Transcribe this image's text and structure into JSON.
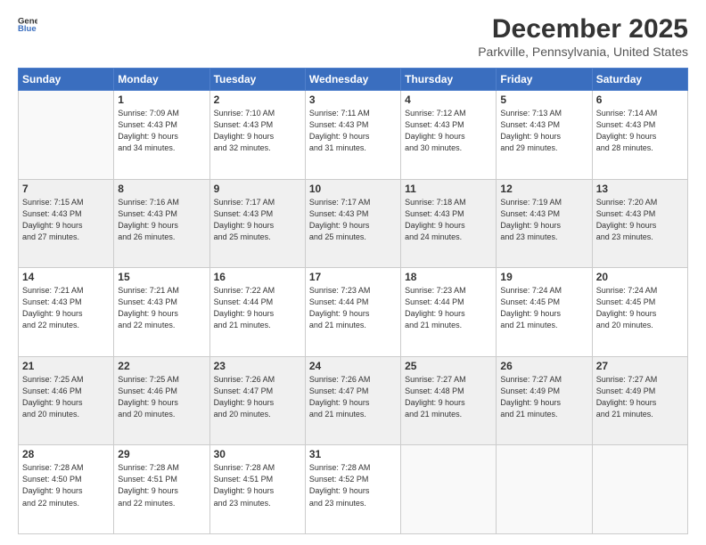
{
  "logo": {
    "line1": "General",
    "line2": "Blue"
  },
  "header": {
    "title": "December 2025",
    "subtitle": "Parkville, Pennsylvania, United States"
  },
  "weekdays": [
    "Sunday",
    "Monday",
    "Tuesday",
    "Wednesday",
    "Thursday",
    "Friday",
    "Saturday"
  ],
  "weeks": [
    [
      {
        "day": "",
        "sunrise": "",
        "sunset": "",
        "daylight": ""
      },
      {
        "day": "1",
        "sunrise": "7:09 AM",
        "sunset": "4:43 PM",
        "dl1": "9 hours",
        "dl2": "and 34 minutes."
      },
      {
        "day": "2",
        "sunrise": "7:10 AM",
        "sunset": "4:43 PM",
        "dl1": "9 hours",
        "dl2": "and 32 minutes."
      },
      {
        "day": "3",
        "sunrise": "7:11 AM",
        "sunset": "4:43 PM",
        "dl1": "9 hours",
        "dl2": "and 31 minutes."
      },
      {
        "day": "4",
        "sunrise": "7:12 AM",
        "sunset": "4:43 PM",
        "dl1": "9 hours",
        "dl2": "and 30 minutes."
      },
      {
        "day": "5",
        "sunrise": "7:13 AM",
        "sunset": "4:43 PM",
        "dl1": "9 hours",
        "dl2": "and 29 minutes."
      },
      {
        "day": "6",
        "sunrise": "7:14 AM",
        "sunset": "4:43 PM",
        "dl1": "9 hours",
        "dl2": "and 28 minutes."
      }
    ],
    [
      {
        "day": "7",
        "sunrise": "7:15 AM",
        "sunset": "4:43 PM",
        "dl1": "9 hours",
        "dl2": "and 27 minutes."
      },
      {
        "day": "8",
        "sunrise": "7:16 AM",
        "sunset": "4:43 PM",
        "dl1": "9 hours",
        "dl2": "and 26 minutes."
      },
      {
        "day": "9",
        "sunrise": "7:17 AM",
        "sunset": "4:43 PM",
        "dl1": "9 hours",
        "dl2": "and 25 minutes."
      },
      {
        "day": "10",
        "sunrise": "7:17 AM",
        "sunset": "4:43 PM",
        "dl1": "9 hours",
        "dl2": "and 25 minutes."
      },
      {
        "day": "11",
        "sunrise": "7:18 AM",
        "sunset": "4:43 PM",
        "dl1": "9 hours",
        "dl2": "and 24 minutes."
      },
      {
        "day": "12",
        "sunrise": "7:19 AM",
        "sunset": "4:43 PM",
        "dl1": "9 hours",
        "dl2": "and 23 minutes."
      },
      {
        "day": "13",
        "sunrise": "7:20 AM",
        "sunset": "4:43 PM",
        "dl1": "9 hours",
        "dl2": "and 23 minutes."
      }
    ],
    [
      {
        "day": "14",
        "sunrise": "7:21 AM",
        "sunset": "4:43 PM",
        "dl1": "9 hours",
        "dl2": "and 22 minutes."
      },
      {
        "day": "15",
        "sunrise": "7:21 AM",
        "sunset": "4:43 PM",
        "dl1": "9 hours",
        "dl2": "and 22 minutes."
      },
      {
        "day": "16",
        "sunrise": "7:22 AM",
        "sunset": "4:44 PM",
        "dl1": "9 hours",
        "dl2": "and 21 minutes."
      },
      {
        "day": "17",
        "sunrise": "7:23 AM",
        "sunset": "4:44 PM",
        "dl1": "9 hours",
        "dl2": "and 21 minutes."
      },
      {
        "day": "18",
        "sunrise": "7:23 AM",
        "sunset": "4:44 PM",
        "dl1": "9 hours",
        "dl2": "and 21 minutes."
      },
      {
        "day": "19",
        "sunrise": "7:24 AM",
        "sunset": "4:45 PM",
        "dl1": "9 hours",
        "dl2": "and 21 minutes."
      },
      {
        "day": "20",
        "sunrise": "7:24 AM",
        "sunset": "4:45 PM",
        "dl1": "9 hours",
        "dl2": "and 20 minutes."
      }
    ],
    [
      {
        "day": "21",
        "sunrise": "7:25 AM",
        "sunset": "4:46 PM",
        "dl1": "9 hours",
        "dl2": "and 20 minutes."
      },
      {
        "day": "22",
        "sunrise": "7:25 AM",
        "sunset": "4:46 PM",
        "dl1": "9 hours",
        "dl2": "and 20 minutes."
      },
      {
        "day": "23",
        "sunrise": "7:26 AM",
        "sunset": "4:47 PM",
        "dl1": "9 hours",
        "dl2": "and 20 minutes."
      },
      {
        "day": "24",
        "sunrise": "7:26 AM",
        "sunset": "4:47 PM",
        "dl1": "9 hours",
        "dl2": "and 21 minutes."
      },
      {
        "day": "25",
        "sunrise": "7:27 AM",
        "sunset": "4:48 PM",
        "dl1": "9 hours",
        "dl2": "and 21 minutes."
      },
      {
        "day": "26",
        "sunrise": "7:27 AM",
        "sunset": "4:49 PM",
        "dl1": "9 hours",
        "dl2": "and 21 minutes."
      },
      {
        "day": "27",
        "sunrise": "7:27 AM",
        "sunset": "4:49 PM",
        "dl1": "9 hours",
        "dl2": "and 21 minutes."
      }
    ],
    [
      {
        "day": "28",
        "sunrise": "7:28 AM",
        "sunset": "4:50 PM",
        "dl1": "9 hours",
        "dl2": "and 22 minutes."
      },
      {
        "day": "29",
        "sunrise": "7:28 AM",
        "sunset": "4:51 PM",
        "dl1": "9 hours",
        "dl2": "and 22 minutes."
      },
      {
        "day": "30",
        "sunrise": "7:28 AM",
        "sunset": "4:51 PM",
        "dl1": "9 hours",
        "dl2": "and 23 minutes."
      },
      {
        "day": "31",
        "sunrise": "7:28 AM",
        "sunset": "4:52 PM",
        "dl1": "9 hours",
        "dl2": "and 23 minutes."
      },
      {
        "day": "",
        "sunrise": "",
        "sunset": "",
        "dl1": "",
        "dl2": ""
      },
      {
        "day": "",
        "sunrise": "",
        "sunset": "",
        "dl1": "",
        "dl2": ""
      },
      {
        "day": "",
        "sunrise": "",
        "sunset": "",
        "dl1": "",
        "dl2": ""
      }
    ]
  ]
}
